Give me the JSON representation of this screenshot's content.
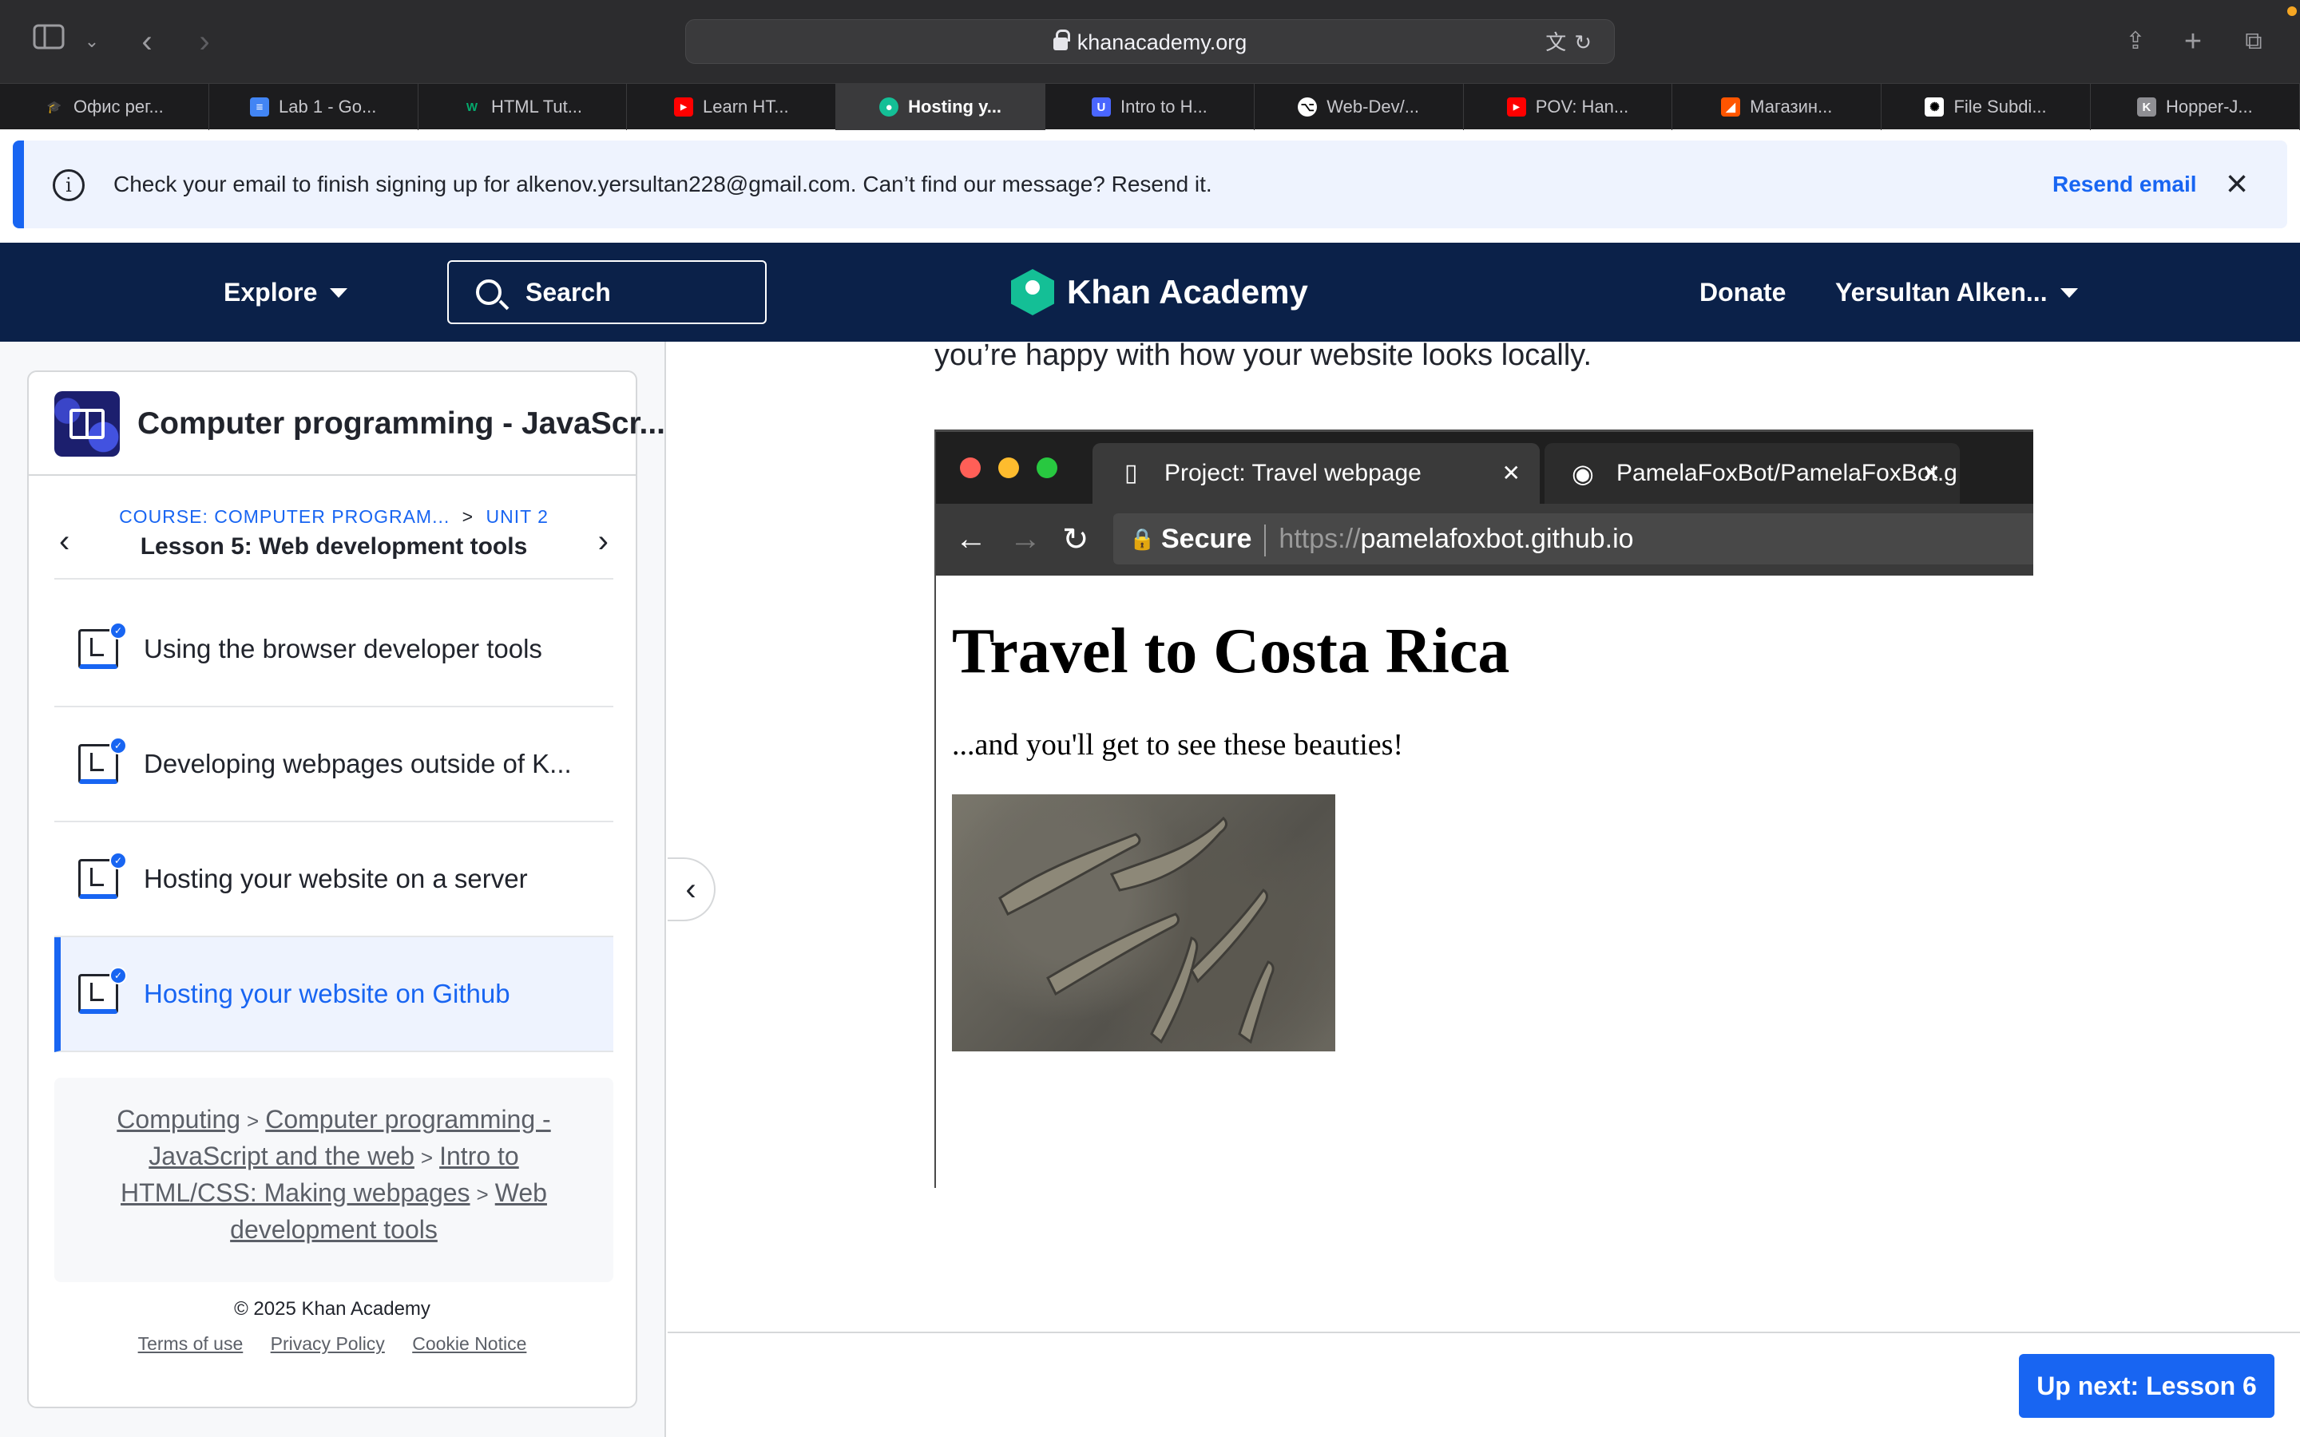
{
  "browser": {
    "url": "khanacademy.org",
    "tabs": [
      {
        "label": "Офис рег...",
        "icon": "graduation-cap-icon"
      },
      {
        "label": "Lab 1 - Go...",
        "icon": "google-docs-icon"
      },
      {
        "label": "HTML Tut...",
        "icon": "w3schools-icon"
      },
      {
        "label": "Learn HT...",
        "icon": "youtube-icon"
      },
      {
        "label": "Hosting y...",
        "icon": "khan-academy-icon"
      },
      {
        "label": "Intro to H...",
        "icon": "udacity-icon"
      },
      {
        "label": "Web-Dev/...",
        "icon": "github-icon"
      },
      {
        "label": "POV: Han...",
        "icon": "youtube-icon"
      },
      {
        "label": "Магазин...",
        "icon": "store-icon"
      },
      {
        "label": "File Subdi...",
        "icon": "openai-icon"
      },
      {
        "label": "Hopper-J...",
        "icon": "k-icon"
      }
    ],
    "active_tab_index": 4
  },
  "banner": {
    "message": "Check your email to finish signing up for alkenov.yersultan228@gmail.com. Can’t find our message? Resend it.",
    "resend_label": "Resend email"
  },
  "header": {
    "explore": "Explore",
    "search": "Search",
    "logo_text": "Khan Academy",
    "donate": "Donate",
    "user": "Yersultan Alken..."
  },
  "sidebar": {
    "course_title": "Computer programming - JavaScr...",
    "course_crumb": "COURSE: COMPUTER PROGRAM...",
    "unit_crumb": "UNIT 2",
    "crumb_separator": ">",
    "lesson_title": "Lesson 5: Web development tools",
    "items": [
      {
        "label": "Using the browser developer tools",
        "current": false
      },
      {
        "label": "Developing webpages outside of K...",
        "current": false
      },
      {
        "label": "Hosting your website on a server",
        "current": false
      },
      {
        "label": "Hosting your website on Github",
        "current": true
      }
    ],
    "breadcrumbs": [
      "Computing",
      "Computer programming - JavaScript and the web",
      "Intro to HTML/CSS: Making webpages",
      "Web development tools"
    ],
    "copyright": "© 2025 Khan Academy",
    "footer_links": [
      "Terms of use",
      "Privacy Policy",
      "Cookie Notice"
    ]
  },
  "main": {
    "text": "you’re happy with how your website looks locally.",
    "screenshot": {
      "tab1": "Project: Travel webpage",
      "tab2": "PamelaFoxBot/PamelaFoxBot.g",
      "secure": "Secure",
      "url_scheme": "https://",
      "url_host": "pamelafoxbot.github.io",
      "heading": "Travel to Costa Rica",
      "paragraph": "...and you'll get to see these beauties!"
    }
  },
  "footer": {
    "up_next": "Up next: Lesson 6"
  },
  "colors": {
    "brand_blue": "#1865f2",
    "header_navy": "#0b2149",
    "ka_green": "#14bf96"
  }
}
